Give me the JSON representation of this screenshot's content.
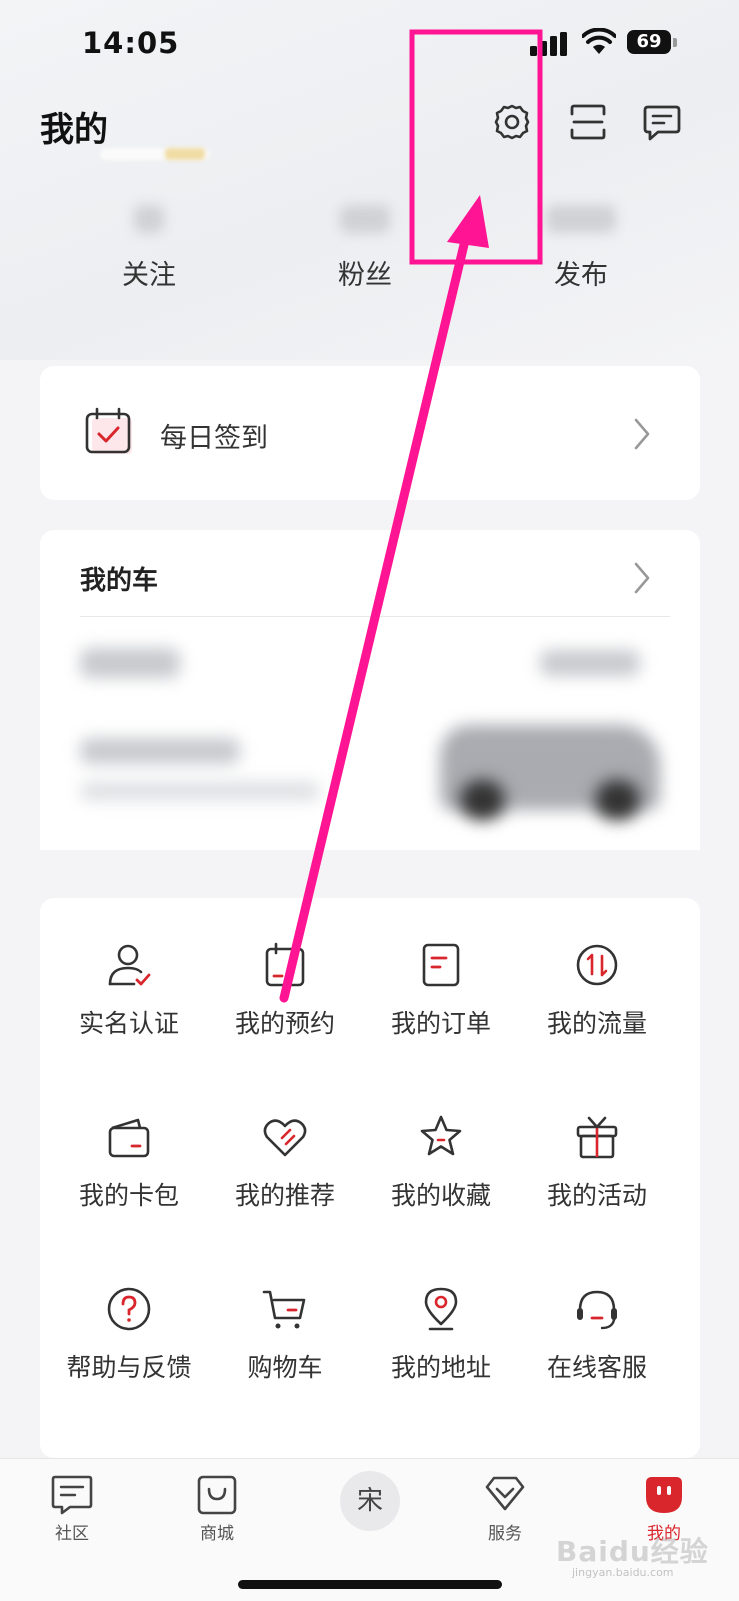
{
  "status_bar": {
    "time": "14:05",
    "battery": "69"
  },
  "header": {
    "title": "我的",
    "icons": [
      "settings-icon",
      "scan-icon",
      "message-icon"
    ]
  },
  "stats": [
    {
      "label": "关注"
    },
    {
      "label": "粉丝"
    },
    {
      "label": "发布"
    }
  ],
  "checkin": {
    "label": "每日签到",
    "icon": "calendar-check-icon"
  },
  "my_car": {
    "title": "我的车"
  },
  "services": [
    {
      "label": "实名认证",
      "icon": "verify-user-icon"
    },
    {
      "label": "我的预约",
      "icon": "calendar-icon"
    },
    {
      "label": "我的订单",
      "icon": "order-icon"
    },
    {
      "label": "我的流量",
      "icon": "data-flow-icon"
    },
    {
      "label": "我的卡包",
      "icon": "wallet-icon"
    },
    {
      "label": "我的推荐",
      "icon": "recommend-icon"
    },
    {
      "label": "我的收藏",
      "icon": "star-icon"
    },
    {
      "label": "我的活动",
      "icon": "gift-icon"
    },
    {
      "label": "帮助与反馈",
      "icon": "help-icon"
    },
    {
      "label": "购物车",
      "icon": "cart-icon"
    },
    {
      "label": "我的地址",
      "icon": "location-icon"
    },
    {
      "label": "在线客服",
      "icon": "headset-icon"
    }
  ],
  "bottom_nav": [
    {
      "label": "社区",
      "icon": "community-icon"
    },
    {
      "label": "商城",
      "icon": "shop-icon"
    },
    {
      "label": "宋",
      "icon": "brand-logo-icon"
    },
    {
      "label": "服务",
      "icon": "service-icon"
    },
    {
      "label": "我的",
      "icon": "profile-icon",
      "active": true
    }
  ],
  "colors": {
    "accent": "#d9262c",
    "annotation": "#ff1493"
  },
  "watermark": {
    "text": "Baidu经验",
    "sub": "jingyan.baidu.com"
  }
}
